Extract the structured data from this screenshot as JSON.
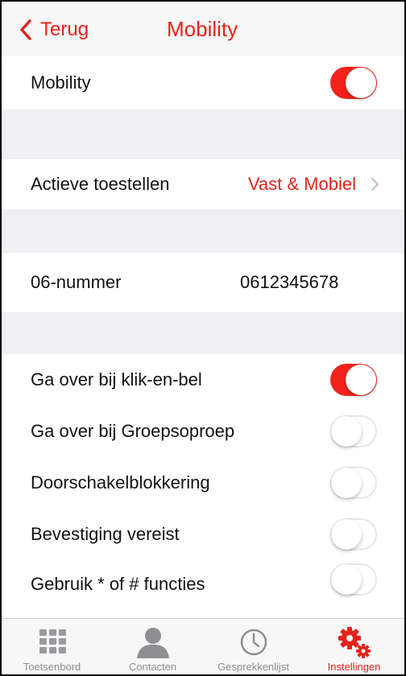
{
  "nav": {
    "back_label": "Terug",
    "title": "Mobility"
  },
  "mobility_row": {
    "label": "Mobility",
    "toggle_on": true
  },
  "devices_row": {
    "label": "Actieve toestellen",
    "value": "Vast & Mobiel"
  },
  "number_row": {
    "label": "06-nummer",
    "value": "0612345678"
  },
  "options": [
    {
      "label": "Ga over bij klik-en-bel",
      "toggle_on": true
    },
    {
      "label": "Ga over bij Groepsoproep",
      "toggle_on": false
    },
    {
      "label": "Doorschakelblokkering",
      "toggle_on": false
    },
    {
      "label": "Bevestiging vereist",
      "toggle_on": false
    },
    {
      "label": "Gebruik * of # functies",
      "toggle_on": false
    }
  ],
  "tabs": [
    {
      "label": "Toetsenbord",
      "icon": "keypad-icon",
      "active": false
    },
    {
      "label": "Contacten",
      "icon": "person-icon",
      "active": false
    },
    {
      "label": "Gesprekkenlijst",
      "icon": "clock-icon",
      "active": false
    },
    {
      "label": "Instellingen",
      "icon": "gears-icon",
      "active": true
    }
  ],
  "colors": {
    "accent": "#e5231b",
    "toggle_on": "#f2231b",
    "group_background": "#efeff4",
    "tab_inactive": "#8e8e93"
  }
}
